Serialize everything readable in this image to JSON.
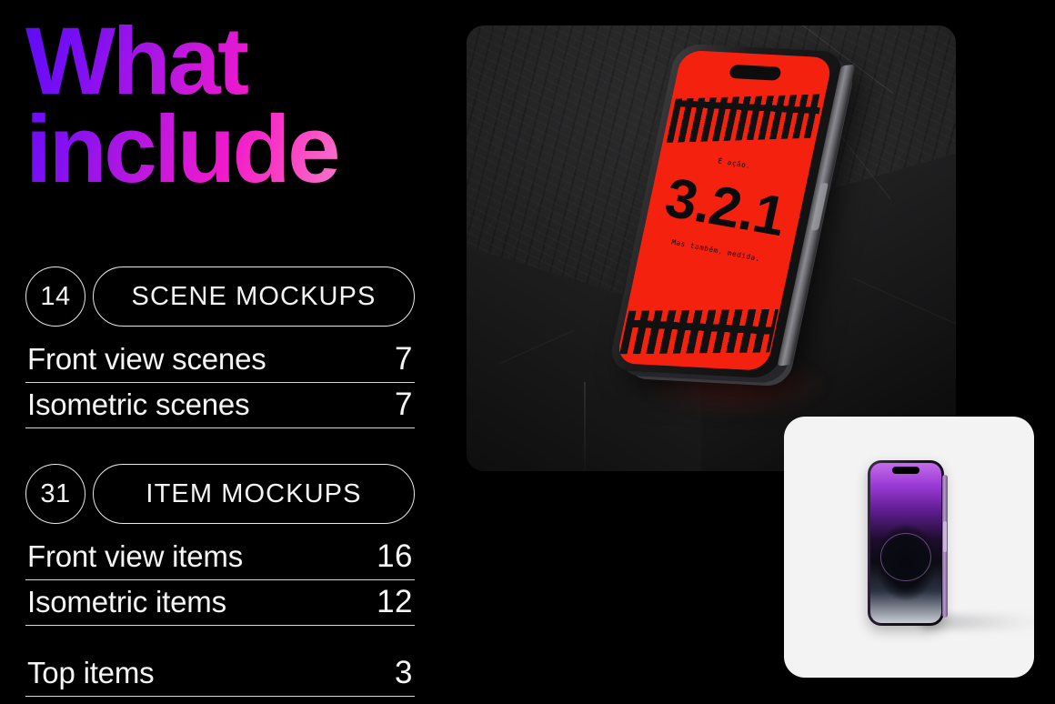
{
  "headline": "What\ninclude",
  "gradient": {
    "start": "#5f0bf7",
    "mid": "#ef1acb",
    "end": "#fbd4f1"
  },
  "groups": [
    {
      "count": "14",
      "title": "SCENE MOCKUPS",
      "rows": [
        {
          "label": "Front view scenes",
          "value": "7"
        },
        {
          "label": "Isometric scenes",
          "value": "7"
        }
      ]
    },
    {
      "count": "31",
      "title": "ITEM MOCKUPS",
      "rows": [
        {
          "label": "Front view items",
          "value": "16"
        },
        {
          "label": "Isometric items",
          "value": "12"
        },
        {
          "label": "Top items",
          "value": "3"
        }
      ]
    }
  ],
  "scene_card": {
    "phone_screen": {
      "line_top": "É ação.",
      "headline": "3.2.1",
      "line_bottom": "Mas também, medida."
    },
    "screen_color": "#f5210f",
    "background_color": "#1d1d1e"
  },
  "item_card": {
    "background_color": "#f3f3f3",
    "phone_color": "#5e1d8e"
  }
}
